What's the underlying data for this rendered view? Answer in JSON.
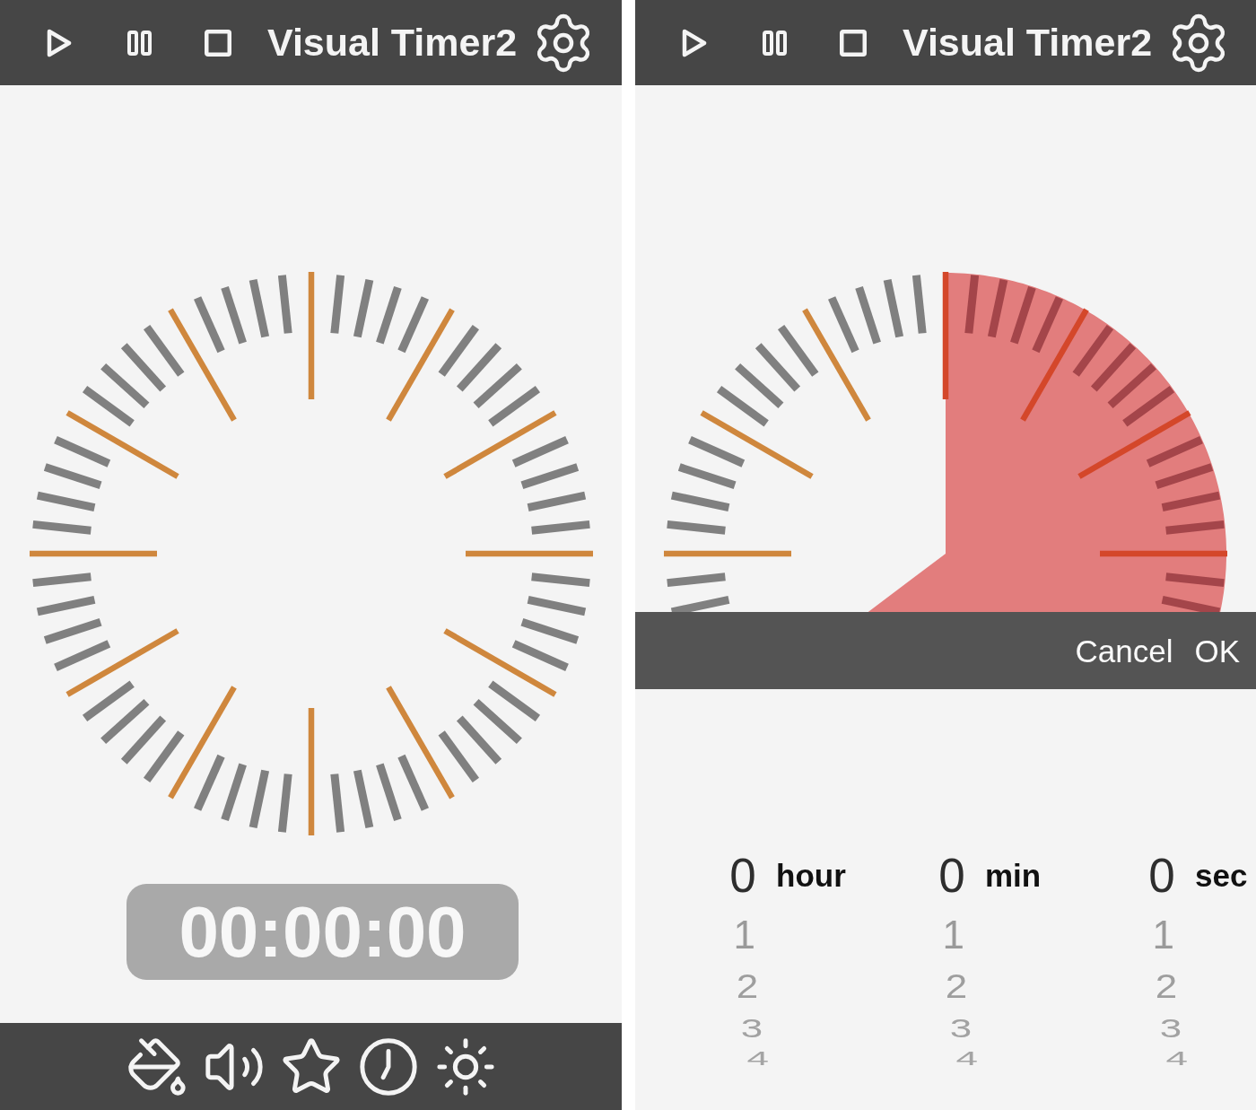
{
  "timer_screen": {
    "toolbar": {
      "title": "Visual Timer2"
    },
    "time_display": "00:00:00"
  },
  "setup_screen": {
    "toolbar": {
      "title": "Visual Timer2"
    },
    "action_bar": {
      "cancel": "Cancel",
      "ok": "OK"
    },
    "picker": {
      "columns": [
        {
          "unit": "hour",
          "values": [
            {
              "label": "0",
              "selected": true
            },
            {
              "label": "1",
              "selected": false
            },
            {
              "label": "2",
              "selected": false
            },
            {
              "label": "3",
              "selected": false
            },
            {
              "label": "4",
              "selected": false
            }
          ]
        },
        {
          "unit": "min",
          "values": [
            {
              "label": "0",
              "selected": true
            },
            {
              "label": "1",
              "selected": false
            },
            {
              "label": "2",
              "selected": false
            },
            {
              "label": "3",
              "selected": false
            },
            {
              "label": "4",
              "selected": false
            }
          ]
        },
        {
          "unit": "sec",
          "values": [
            {
              "label": "0",
              "selected": true
            },
            {
              "label": "1",
              "selected": false
            },
            {
              "label": "2",
              "selected": false
            },
            {
              "label": "3",
              "selected": false
            },
            {
              "label": "4",
              "selected": false
            }
          ]
        }
      ]
    }
  }
}
